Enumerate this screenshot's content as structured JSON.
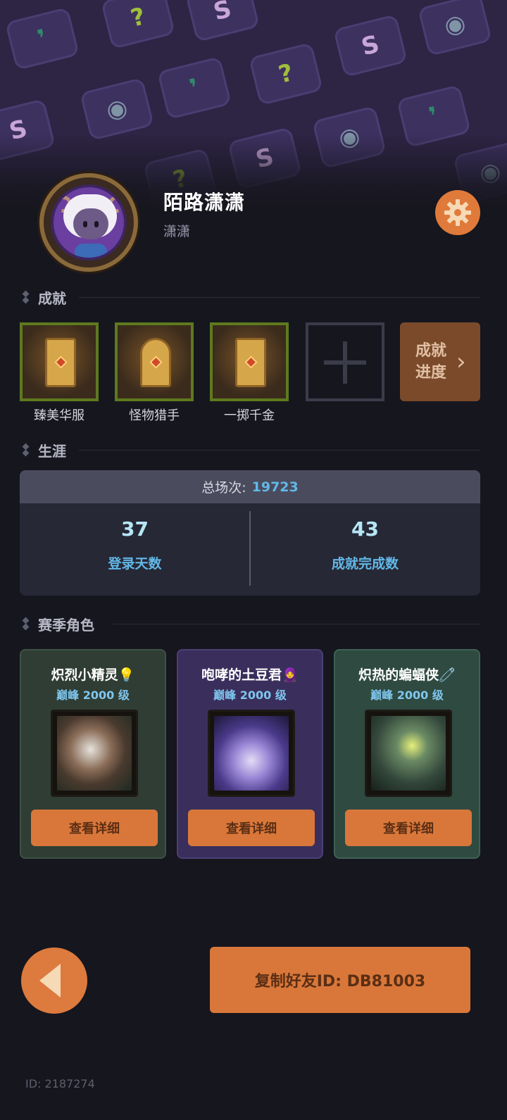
{
  "profile": {
    "nickname": "陌路潇潇",
    "subname": "潇潇"
  },
  "icons": {
    "settings": "gear-icon",
    "back": "back-arrow-icon",
    "progress_chevron": "chevron-right-icon"
  },
  "achievements": {
    "section_title": "成就",
    "items": [
      {
        "label": "臻美华服"
      },
      {
        "label": "怪物猎手"
      },
      {
        "label": "一掷千金"
      }
    ],
    "progress_label_line1": "成就",
    "progress_label_line2": "进度",
    "chevron": "›"
  },
  "career": {
    "section_title": "生涯",
    "total_label": "总场次:",
    "total_value": "19723",
    "stats": [
      {
        "value": "37",
        "label": "登录天数"
      },
      {
        "value": "43",
        "label": "成就完成数"
      }
    ]
  },
  "season": {
    "section_title": "赛季角色",
    "characters": [
      {
        "name": "炽烈小精灵💡",
        "level": "巅峰 2000 级",
        "button": "查看详细"
      },
      {
        "name": "咆哮的土豆君🧕",
        "level": "巅峰 2000 级",
        "button": "查看详细"
      },
      {
        "name": "炽热的蝙蝠侠🧷",
        "level": "巅峰 2000 级",
        "button": "查看详细"
      }
    ]
  },
  "footer": {
    "copy_button": "复制好友ID: DB81003",
    "user_id": "ID: 2187274"
  },
  "colors": {
    "accent_orange": "#d9773a",
    "stat_blue": "#62b8e8",
    "background": "#16161e",
    "banner": "#2e2444"
  }
}
